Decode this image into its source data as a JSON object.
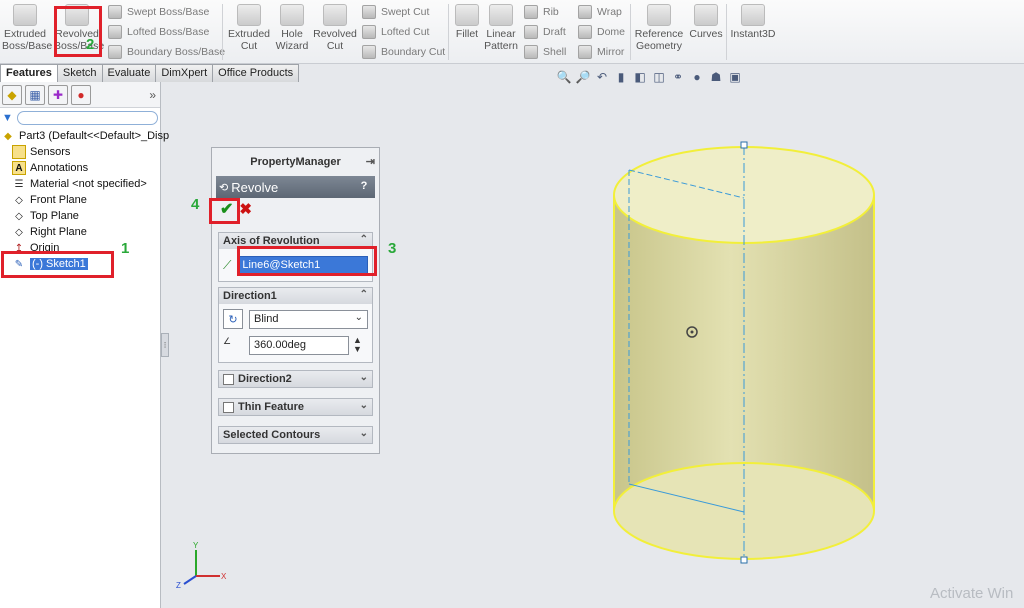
{
  "ribbon": {
    "extruded_boss": "Extruded Boss/Base",
    "revolved_boss": "Revolved Boss/Base",
    "swept_boss": "Swept Boss/Base",
    "lofted_boss": "Lofted Boss/Base",
    "boundary_boss": "Boundary Boss/Base",
    "extruded_cut": "Extruded Cut",
    "hole_wizard": "Hole Wizard",
    "revolved_cut": "Revolved Cut",
    "swept_cut": "Swept Cut",
    "lofted_cut": "Lofted Cut",
    "boundary_cut": "Boundary Cut",
    "fillet": "Fillet",
    "linear_pattern": "Linear Pattern",
    "rib": "Rib",
    "draft": "Draft",
    "shell": "Shell",
    "wrap": "Wrap",
    "dome": "Dome",
    "mirror": "Mirror",
    "reference_geometry": "Reference Geometry",
    "curves": "Curves",
    "instant3d": "Instant3D"
  },
  "tabs": [
    "Features",
    "Sketch",
    "Evaluate",
    "DimXpert",
    "Office Products"
  ],
  "tree": {
    "part": "Part3  (Default<<Default>_Disp",
    "items": [
      "Sensors",
      "Annotations",
      "Material <not specified>",
      "Front Plane",
      "Top Plane",
      "Right Plane",
      "Origin",
      "(-) Sketch1"
    ]
  },
  "property_manager": {
    "title": "PropertyManager",
    "feature": "Revolve",
    "help": "?",
    "axis_group": "Axis of Revolution",
    "axis_value": "Line6@Sketch1",
    "direction1_group": "Direction1",
    "end_condition": "Blind",
    "angle": "360.00deg",
    "direction2_group": "Direction2",
    "thin_feature_group": "Thin Feature",
    "selected_contours_group": "Selected Contours"
  },
  "annotations": [
    "1",
    "2",
    "3",
    "4"
  ],
  "watermark": "Activate Win",
  "colors": {
    "annotation_red": "#e0202a",
    "annotation_green": "#2aa83a",
    "preview_fill": "#e0dc9a",
    "preview_edge": "#f2ef3a",
    "axis_line": "#3a9ad9"
  }
}
